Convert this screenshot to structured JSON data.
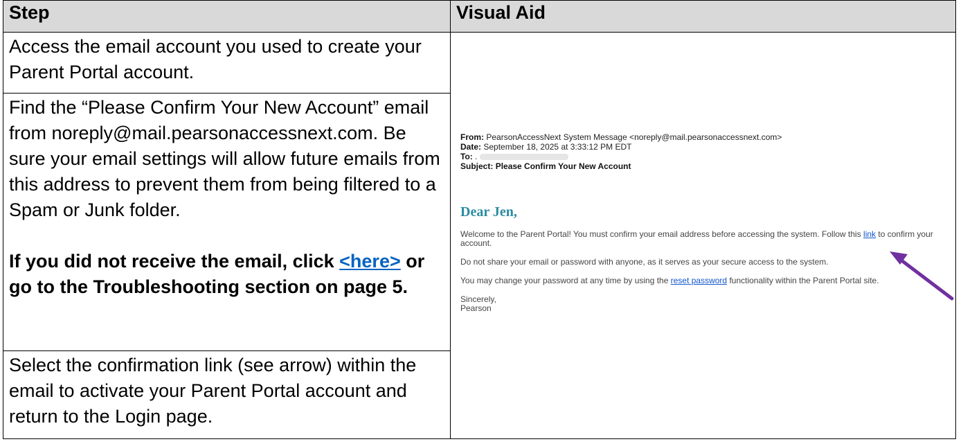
{
  "table": {
    "headers": {
      "step": "Step",
      "visual_aid": "Visual Aid"
    },
    "row1": {
      "text": "Access the email account you used to create your Parent Portal account."
    },
    "row2": {
      "text": "Find the “Please Confirm Your New Account” email from noreply@mail.pearsonaccessnext.com. Be sure your email settings will allow future emails from this address to prevent them from being filtered to a Spam or Junk folder.",
      "bold_before": "If you did not receive the email, click ",
      "bold_link": "<here>",
      "bold_after": " or go to the Troubleshooting section on page 5."
    },
    "row3": {
      "text": "Select the confirmation link (see arrow) within the email to activate your Parent Portal account and return to the Login page."
    }
  },
  "email": {
    "from_label": "From:",
    "from_value": "PearsonAccessNext System Message <noreply@mail.pearsonaccessnext.com>",
    "date_label": "Date:",
    "date_value": "September 18, 2025 at 3:33:12 PM EDT",
    "to_label": "To:",
    "to_value": ".",
    "subject_label": "Subject:",
    "subject_value": "Please Confirm Your New Account",
    "greeting": "Dear Jen,",
    "p1_before": "Welcome to the Parent Portal! You must confirm your email address before accessing the system. Follow this ",
    "p1_link": "link",
    "p1_after": " to confirm your account.",
    "p2": "Do not share your email or password with anyone, as it serves as your secure access to the system.",
    "p3_before": "You may change your password at any time by using the ",
    "p3_link": "reset password",
    "p3_after": " functionality within the Parent Portal site.",
    "closing": "Sincerely,",
    "signature": "Pearson"
  },
  "colors": {
    "header_bg": "#d9d9d9",
    "link": "#0563c1",
    "greeting": "#2b8ca0",
    "arrow": "#7030a0"
  }
}
